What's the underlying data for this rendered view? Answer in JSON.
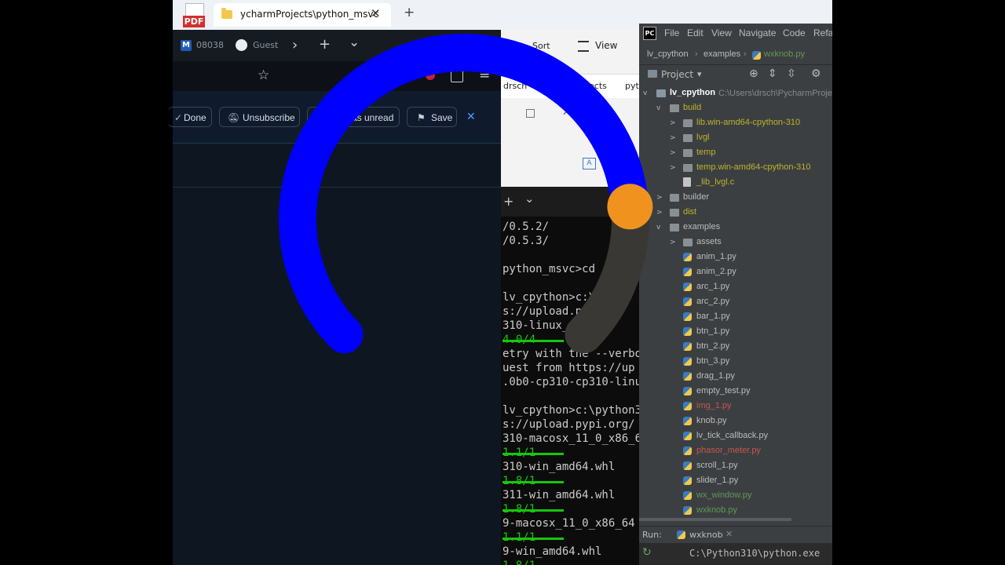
{
  "pdf_icon_label": "PDF",
  "explorer_tab": {
    "title": "ycharmProjects\\python_msvc",
    "close": "✕"
  },
  "new_tab": "+",
  "mail": {
    "tab_text": "08038",
    "guest_text": "Guest",
    "chevron": "›",
    "plus": "+",
    "dropdown": "⌄",
    "star": "☆",
    "menu": "≡",
    "done": "Done",
    "unsubscribe": "Unsubscribe",
    "mark_unread": "as unread",
    "save": "Save",
    "close": "✕"
  },
  "explorer": {
    "sort": "Sort",
    "view": "View",
    "path_part1": "drsch",
    "path_part2": "ects",
    "path_part3": "pyt"
  },
  "terminal": {
    "plus": "+",
    "dropdown": "⌄",
    "lines": [
      {
        "text": "/0.5.2/",
        "green": false
      },
      {
        "text": "/0.5.3/",
        "green": false
      },
      {
        "text": "",
        "green": false
      },
      {
        "text": "python_msvc>cd '",
        "green": false
      },
      {
        "text": "",
        "green": false
      },
      {
        "text": "lv_cpython>c:\\",
        "green": false
      },
      {
        "text": "s://upload.p",
        "green": false
      },
      {
        "text": "310-linux_",
        "green": false
      },
      {
        "text": "              4.0/4",
        "green": true
      },
      {
        "text": "etry with the --verbo",
        "green": false
      },
      {
        "text": "uest from https://up",
        "green": false
      },
      {
        "text": ".0b0-cp310-cp310-linu",
        "green": false
      },
      {
        "text": "",
        "green": false
      },
      {
        "text": "lv_cpython>c:\\python3",
        "green": false
      },
      {
        "text": "s://upload.pypi.org/",
        "green": false
      },
      {
        "text": "310-macosx_11_0_x86_6",
        "green": false
      },
      {
        "text": "              1.1/1",
        "green": true
      },
      {
        "text": "310-win_amd64.whl",
        "green": false
      },
      {
        "text": "              1.8/1",
        "green": true
      },
      {
        "text": "311-win_amd64.whl",
        "green": false
      },
      {
        "text": "              1.8/1",
        "green": true
      },
      {
        "text": "9-macosx_11_0_x86_64",
        "green": false
      },
      {
        "text": "              1.1/1",
        "green": true
      },
      {
        "text": "9-win_amd64.whl",
        "green": false
      },
      {
        "text": "              1.8/1",
        "green": true
      }
    ]
  },
  "pycharm": {
    "logo": "PC",
    "menu": [
      "File",
      "Edit",
      "View",
      "Navigate",
      "Code",
      "Refac"
    ],
    "breadcrumb": [
      "lv_cpython",
      "examples",
      "wxknob.py"
    ],
    "project_label": "Project",
    "root_name": "lv_cpython",
    "root_path": "C:\\Users\\drsch\\PycharmProje",
    "tree": [
      {
        "label": "build",
        "kind": "folder",
        "color": "#bbb529",
        "indent": 1,
        "arrow": "v"
      },
      {
        "label": "lib.win-amd64-cpython-310",
        "kind": "folder",
        "color": "#bbb529",
        "indent": 2,
        "arrow": ">"
      },
      {
        "label": "lvgl",
        "kind": "folder",
        "color": "#bbb529",
        "indent": 2,
        "arrow": ">"
      },
      {
        "label": "temp",
        "kind": "folder",
        "color": "#bbb529",
        "indent": 2,
        "arrow": ">"
      },
      {
        "label": "temp.win-amd64-cpython-310",
        "kind": "folder",
        "color": "#bbb529",
        "indent": 2,
        "arrow": ">"
      },
      {
        "label": "_lib_lvgl.c",
        "kind": "cfile",
        "color": "#bbb529",
        "indent": 2,
        "arrow": ""
      },
      {
        "label": "builder",
        "kind": "folder",
        "color": "#bbbbbb",
        "indent": 1,
        "arrow": ">"
      },
      {
        "label": "dist",
        "kind": "folder",
        "color": "#bbb529",
        "indent": 1,
        "arrow": ">"
      },
      {
        "label": "examples",
        "kind": "folder",
        "color": "#bbbbbb",
        "indent": 1,
        "arrow": "v"
      },
      {
        "label": "assets",
        "kind": "folder",
        "color": "#bbbbbb",
        "indent": 2,
        "arrow": ">"
      },
      {
        "label": "anim_1.py",
        "kind": "py",
        "color": "#bbbbbb",
        "indent": 2,
        "arrow": ""
      },
      {
        "label": "anim_2.py",
        "kind": "py",
        "color": "#bbbbbb",
        "indent": 2,
        "arrow": ""
      },
      {
        "label": "arc_1.py",
        "kind": "py",
        "color": "#bbbbbb",
        "indent": 2,
        "arrow": ""
      },
      {
        "label": "arc_2.py",
        "kind": "py",
        "color": "#bbbbbb",
        "indent": 2,
        "arrow": ""
      },
      {
        "label": "bar_1.py",
        "kind": "py",
        "color": "#bbbbbb",
        "indent": 2,
        "arrow": ""
      },
      {
        "label": "btn_1.py",
        "kind": "py",
        "color": "#bbbbbb",
        "indent": 2,
        "arrow": ""
      },
      {
        "label": "btn_2.py",
        "kind": "py",
        "color": "#bbbbbb",
        "indent": 2,
        "arrow": ""
      },
      {
        "label": "btn_3.py",
        "kind": "py",
        "color": "#bbbbbb",
        "indent": 2,
        "arrow": ""
      },
      {
        "label": "drag_1.py",
        "kind": "py",
        "color": "#bbbbbb",
        "indent": 2,
        "arrow": ""
      },
      {
        "label": "empty_test.py",
        "kind": "py",
        "color": "#bbbbbb",
        "indent": 2,
        "arrow": ""
      },
      {
        "label": "img_1.py",
        "kind": "py",
        "color": "#c75450",
        "indent": 2,
        "arrow": ""
      },
      {
        "label": "knob.py",
        "kind": "py",
        "color": "#bbbbbb",
        "indent": 2,
        "arrow": ""
      },
      {
        "label": "lv_tick_callback.py",
        "kind": "py",
        "color": "#bbbbbb",
        "indent": 2,
        "arrow": ""
      },
      {
        "label": "phasor_meter.py",
        "kind": "py",
        "color": "#c75450",
        "indent": 2,
        "arrow": ""
      },
      {
        "label": "scroll_1.py",
        "kind": "py",
        "color": "#bbbbbb",
        "indent": 2,
        "arrow": ""
      },
      {
        "label": "slider_1.py",
        "kind": "py",
        "color": "#bbbbbb",
        "indent": 2,
        "arrow": ""
      },
      {
        "label": "wx_window.py",
        "kind": "py",
        "color": "#629755",
        "indent": 2,
        "arrow": ""
      },
      {
        "label": "wxknob.py",
        "kind": "py",
        "color": "#629755",
        "indent": 2,
        "arrow": ""
      }
    ],
    "run_label": "Run:",
    "run_config": "wxknob",
    "run_output": "C:\\Python310\\python.exe"
  },
  "knob": {
    "value_fraction": 0.82,
    "track_color": "#0000ff",
    "rest_color": "#3a3835",
    "handle_color": "#f0931e"
  }
}
